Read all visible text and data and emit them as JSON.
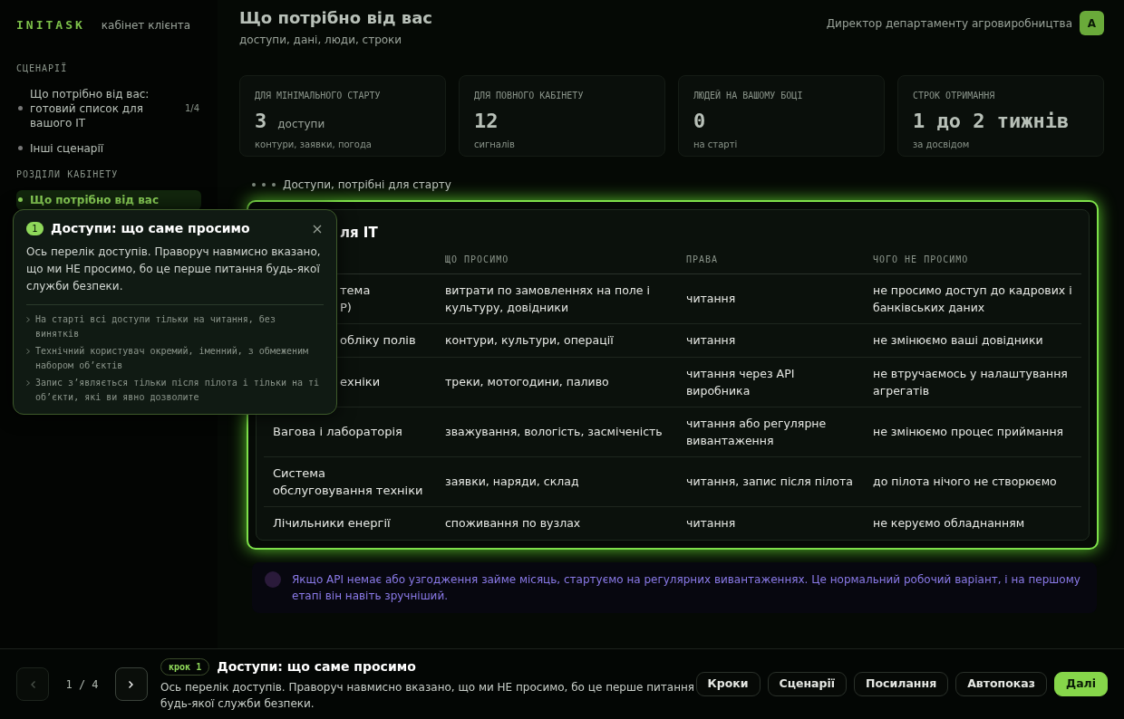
{
  "sidebar": {
    "logo": "INITASK",
    "subtitle": "кабінет клієнта",
    "groups": [
      {
        "heading": "СЦЕНАРІЇ",
        "items": [
          {
            "label": "Що потрібно від вас: готовий список для вашого IT",
            "badge": "1/4",
            "selected": false
          },
          {
            "label": "Інші сценарії",
            "selected": false
          }
        ]
      },
      {
        "heading": "РОЗДІЛИ КАБІНЕТУ",
        "items": [
          {
            "label": "Що потрібно від вас",
            "selected": true
          }
        ]
      }
    ]
  },
  "header": {
    "title": "Що потрібно від вас",
    "subtitle": "доступи, дані, люди, строки",
    "user": "Директор департаменту агровиробництва",
    "avatar": "А"
  },
  "stats": [
    {
      "label": "ДЛЯ МІНІМАЛЬНОГО СТАРТУ",
      "value": "3",
      "unit": "доступи",
      "note": "контури, заявки, погода"
    },
    {
      "label": "ДЛЯ ПОВНОГО КАБІНЕТУ",
      "value": "12",
      "note": "сигналів"
    },
    {
      "label": "ЛЮДЕЙ НА ВАШОМУ БОЦІ",
      "value": "0",
      "note": "на старті"
    },
    {
      "label": "СТРОК ОТРИМАННЯ",
      "value": "1 до 2 тижнів",
      "note": "за досвідом"
    }
  ],
  "section": {
    "title": "Доступи, потрібні для старту"
  },
  "table": {
    "title": "ля IT",
    "columns": [
      "ЩО ПРОСИМО",
      "ПРАВА",
      "ЧОГО НЕ ПРОСИМО"
    ],
    "rows": [
      {
        "system": "тема\nP)",
        "clipped": true,
        "ask": "витрати по замовленнях на поле і культуру, довідники",
        "rights": "читання",
        "not_ask": "не просимо доступ до кадрових і банківських даних"
      },
      {
        "system": "обліку полів",
        "clipped": true,
        "ask": "контури, культури, операції",
        "rights": "читання",
        "not_ask": "не змінюємо ваші довідники"
      },
      {
        "system": "ехніки",
        "clipped": true,
        "ask": "треки, мотогодини, паливо",
        "rights": "читання через API виробника",
        "not_ask": "не втручаємось у налаштування агрегатів"
      },
      {
        "system": "Вагова і лабораторія",
        "clipped": false,
        "ask": "зважування, вологість, засміченість",
        "rights": "читання або регулярне вивантаження",
        "not_ask": "не змінюємо процес приймання"
      },
      {
        "system": "Система обслуговування техніки",
        "clipped": false,
        "ask": "заявки, наряди, склад",
        "rights": "читання, запис після пілота",
        "not_ask": "до пілота нічого не створюємо"
      },
      {
        "system": "Лічильники енергії",
        "clipped": false,
        "ask": "споживання по вузлах",
        "rights": "читання",
        "not_ask": "не керуємо обладнанням"
      }
    ]
  },
  "note": {
    "text": "Якщо API немає або узгодження займе місяць, стартуємо на регулярних вивантаженнях. Це нормальний робочий варіант, і на першому етапі він навіть зручніший."
  },
  "popover": {
    "step": "1",
    "title": "Доступи: що саме просимо",
    "text": "Ось перелік доступів. Праворуч навмисно вказано, що ми НЕ просимо, бо це перше питання будь-якої служби безпеки.",
    "points": [
      "На старті всі доступи тільки на читання, без винятків",
      "Технічний користувач окремий, іменний, з обмеженим набором об’єктів",
      "Запис з’являється тільки після пілота і тільки на ті об’єкти, які ви явно дозволите"
    ]
  },
  "tour": {
    "counter": "1 / 4",
    "prev_disabled": true,
    "step_badge": "крок 1",
    "title": "Доступи: що саме просимо",
    "text": "Ось перелік доступів. Праворуч навмисно вказано, що ми НЕ просимо, бо це перше питання будь-якої служби безпеки.",
    "buttons": [
      {
        "label": "Кроки",
        "kind": "plain"
      },
      {
        "label": "Сценарії",
        "kind": "plain"
      },
      {
        "label": "Посилання",
        "kind": "plain"
      },
      {
        "label": "Автопоказ",
        "kind": "plain"
      },
      {
        "label": "Далі",
        "kind": "primary"
      }
    ]
  }
}
